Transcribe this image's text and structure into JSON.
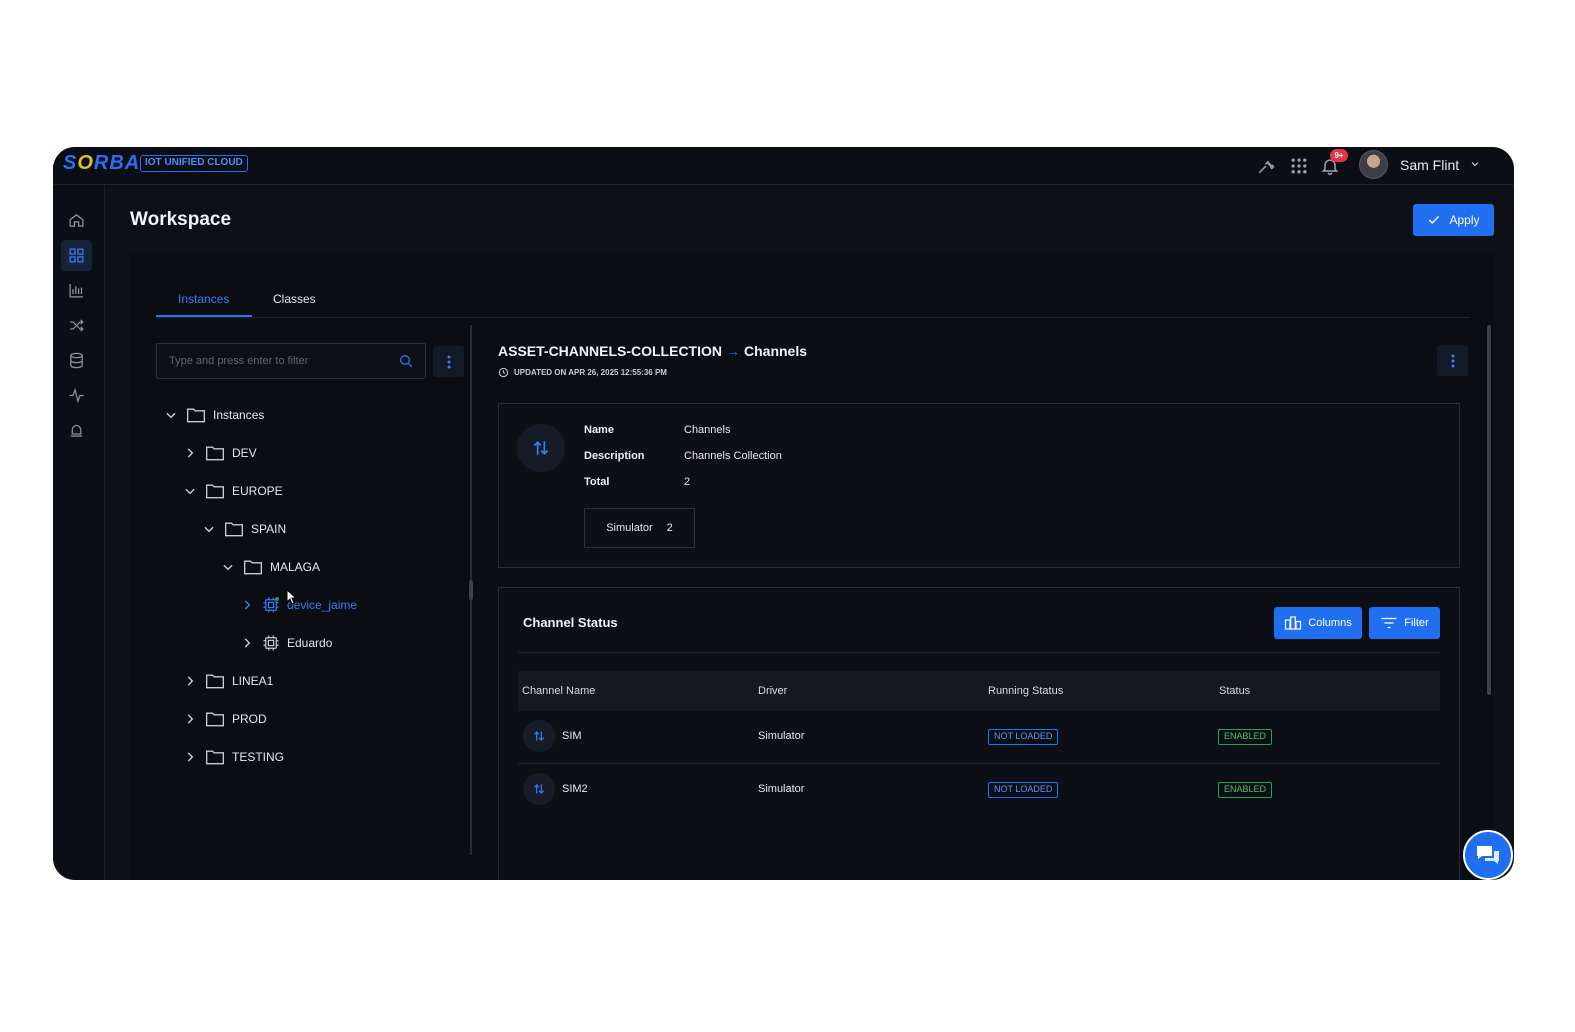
{
  "brand": {
    "logo_text_a": "S",
    "logo_text_o": "O",
    "logo_text_b": "RBA",
    "badge": "IOT UNIFIED CLOUD"
  },
  "topbar": {
    "notification_count": "9+",
    "user_name": "Sam Flint"
  },
  "page": {
    "title": "Workspace",
    "apply_label": "Apply"
  },
  "tabs": [
    {
      "label": "Instances",
      "active": true
    },
    {
      "label": "Classes",
      "active": false
    }
  ],
  "filter": {
    "placeholder": "Type and press enter to filter",
    "value": ""
  },
  "tree": [
    {
      "label": "Instances",
      "expanded": true
    },
    {
      "label": "DEV",
      "expanded": false
    },
    {
      "label": "EUROPE",
      "expanded": true
    },
    {
      "label": "SPAIN",
      "expanded": true
    },
    {
      "label": "MALAGA",
      "expanded": true
    },
    {
      "label": "device_jaime",
      "expanded": false,
      "selected": true
    },
    {
      "label": "Eduardo",
      "expanded": false
    },
    {
      "label": "LINEA1",
      "expanded": false
    },
    {
      "label": "PROD",
      "expanded": false
    },
    {
      "label": "TESTING",
      "expanded": false
    }
  ],
  "asset": {
    "path": "ASSET-CHANNELS-COLLECTION",
    "arrow": "→",
    "name": "Channels",
    "updated": "UPDATED ON APR 26, 2025 12:55:36 PM"
  },
  "info": {
    "name_label": "Name",
    "name_value": "Channels",
    "description_label": "Description",
    "description_value": "Channels Collection",
    "total_label": "Total",
    "total_value": "2",
    "chip_label": "Simulator",
    "chip_count": "2"
  },
  "channel_status": {
    "title": "Channel Status",
    "columns_button": "Columns",
    "filter_button": "Filter",
    "headers": [
      "Channel Name",
      "Driver",
      "Running Status",
      "Status"
    ],
    "rows": [
      {
        "name": "SIM",
        "driver": "Simulator",
        "running_status": "NOT LOADED",
        "status": "ENABLED"
      },
      {
        "name": "SIM2",
        "driver": "Simulator",
        "running_status": "NOT LOADED",
        "status": "ENABLED"
      }
    ]
  },
  "colors": {
    "accent": "#1f6ff0",
    "background": "#0d1117",
    "enabled": "#2e9e4f",
    "notif": "#e5334b"
  }
}
